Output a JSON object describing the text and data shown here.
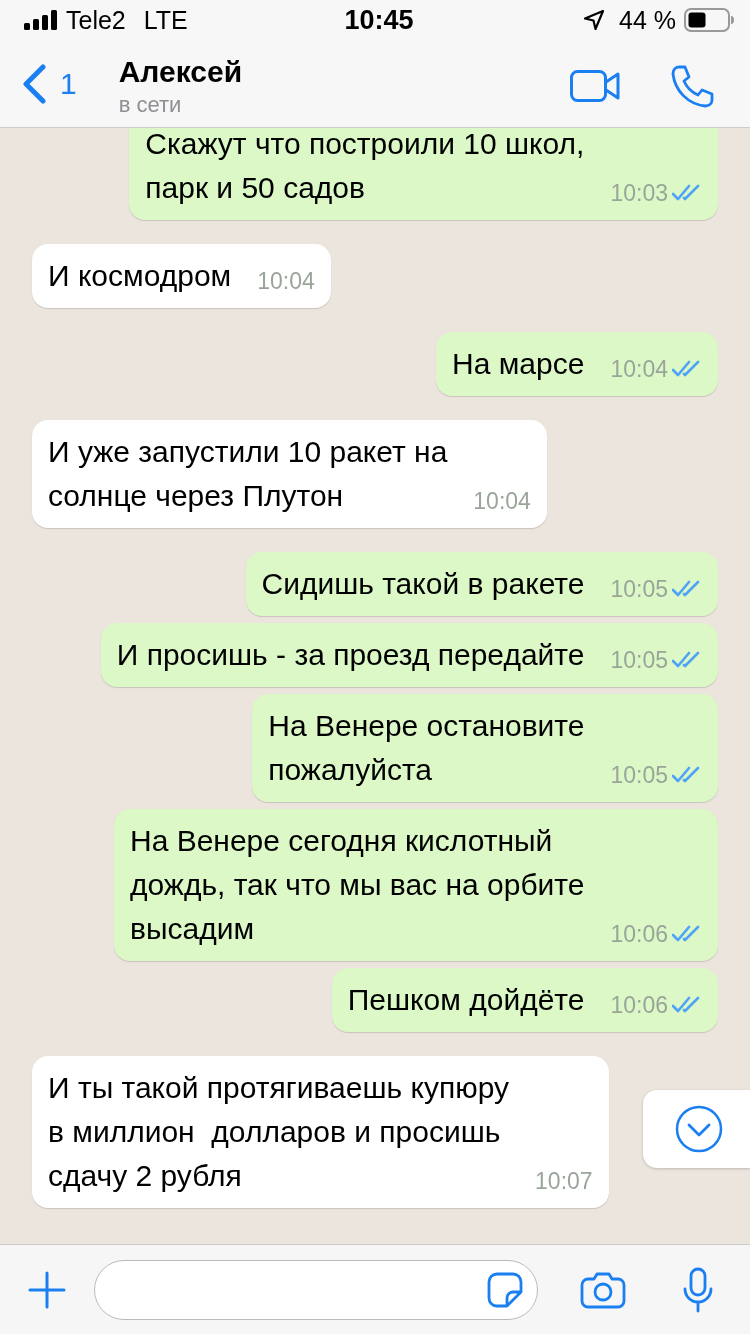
{
  "status_bar": {
    "carrier": "Tele2",
    "network": "LTE",
    "time": "10:45",
    "battery": "44 %"
  },
  "header": {
    "back_count": "1",
    "contact_name": "Алексей",
    "contact_status": "в сети"
  },
  "messages": [
    {
      "kind": "outgoing",
      "text": "Скажут что построили 10 школ,\nпарк и 50 садов",
      "time": "10:03",
      "read": true
    },
    {
      "kind": "incoming",
      "text": "И космодром",
      "time": "10:04"
    },
    {
      "kind": "outgoing",
      "text": "На марсе",
      "time": "10:04",
      "read": true
    },
    {
      "kind": "incoming",
      "text": "И уже запустили 10 ракет на\nсолнце через Плутон",
      "time": "10:04"
    },
    {
      "kind": "outgoing",
      "text": "Сидишь такой в ракете",
      "time": "10:05",
      "read": true
    },
    {
      "kind": "outgoing",
      "text": "И просишь - за проезд передайте",
      "time": "10:05",
      "read": true
    },
    {
      "kind": "outgoing",
      "text": "На Венере остановите\nпожалуйста",
      "time": "10:05",
      "read": true
    },
    {
      "kind": "outgoing",
      "text": "На Венере сегодня кислотный\nдождь, так что мы вас на орбите\nвысадим",
      "time": "10:06",
      "read": true
    },
    {
      "kind": "outgoing",
      "text": "Пешком дойдёте",
      "time": "10:06",
      "read": true
    },
    {
      "kind": "incoming",
      "text": "И ты такой протягиваешь купюру\nв миллион  долларов и просишь\nсдачу 2 рубля",
      "time": "10:07"
    }
  ]
}
